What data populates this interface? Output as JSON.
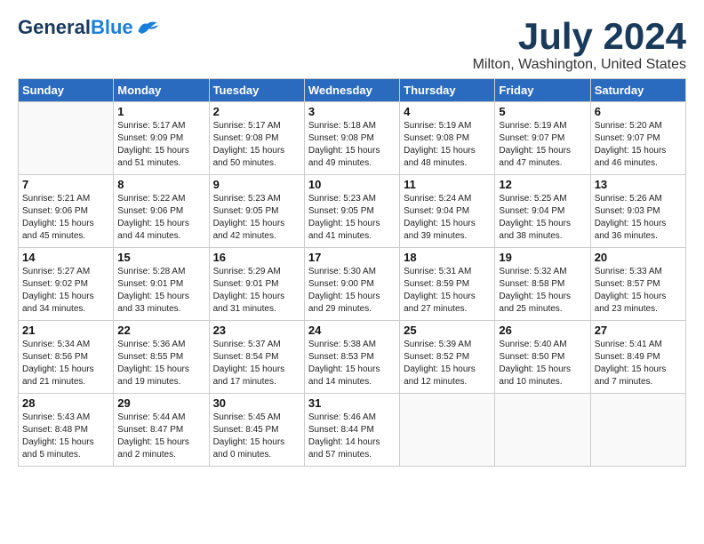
{
  "header": {
    "logo_general": "General",
    "logo_blue": "Blue",
    "month": "July 2024",
    "location": "Milton, Washington, United States"
  },
  "columns": [
    "Sunday",
    "Monday",
    "Tuesday",
    "Wednesday",
    "Thursday",
    "Friday",
    "Saturday"
  ],
  "weeks": [
    [
      {
        "day": "",
        "detail": ""
      },
      {
        "day": "1",
        "detail": "Sunrise: 5:17 AM\nSunset: 9:09 PM\nDaylight: 15 hours\nand 51 minutes."
      },
      {
        "day": "2",
        "detail": "Sunrise: 5:17 AM\nSunset: 9:08 PM\nDaylight: 15 hours\nand 50 minutes."
      },
      {
        "day": "3",
        "detail": "Sunrise: 5:18 AM\nSunset: 9:08 PM\nDaylight: 15 hours\nand 49 minutes."
      },
      {
        "day": "4",
        "detail": "Sunrise: 5:19 AM\nSunset: 9:08 PM\nDaylight: 15 hours\nand 48 minutes."
      },
      {
        "day": "5",
        "detail": "Sunrise: 5:19 AM\nSunset: 9:07 PM\nDaylight: 15 hours\nand 47 minutes."
      },
      {
        "day": "6",
        "detail": "Sunrise: 5:20 AM\nSunset: 9:07 PM\nDaylight: 15 hours\nand 46 minutes."
      }
    ],
    [
      {
        "day": "7",
        "detail": "Sunrise: 5:21 AM\nSunset: 9:06 PM\nDaylight: 15 hours\nand 45 minutes."
      },
      {
        "day": "8",
        "detail": "Sunrise: 5:22 AM\nSunset: 9:06 PM\nDaylight: 15 hours\nand 44 minutes."
      },
      {
        "day": "9",
        "detail": "Sunrise: 5:23 AM\nSunset: 9:05 PM\nDaylight: 15 hours\nand 42 minutes."
      },
      {
        "day": "10",
        "detail": "Sunrise: 5:23 AM\nSunset: 9:05 PM\nDaylight: 15 hours\nand 41 minutes."
      },
      {
        "day": "11",
        "detail": "Sunrise: 5:24 AM\nSunset: 9:04 PM\nDaylight: 15 hours\nand 39 minutes."
      },
      {
        "day": "12",
        "detail": "Sunrise: 5:25 AM\nSunset: 9:04 PM\nDaylight: 15 hours\nand 38 minutes."
      },
      {
        "day": "13",
        "detail": "Sunrise: 5:26 AM\nSunset: 9:03 PM\nDaylight: 15 hours\nand 36 minutes."
      }
    ],
    [
      {
        "day": "14",
        "detail": "Sunrise: 5:27 AM\nSunset: 9:02 PM\nDaylight: 15 hours\nand 34 minutes."
      },
      {
        "day": "15",
        "detail": "Sunrise: 5:28 AM\nSunset: 9:01 PM\nDaylight: 15 hours\nand 33 minutes."
      },
      {
        "day": "16",
        "detail": "Sunrise: 5:29 AM\nSunset: 9:01 PM\nDaylight: 15 hours\nand 31 minutes."
      },
      {
        "day": "17",
        "detail": "Sunrise: 5:30 AM\nSunset: 9:00 PM\nDaylight: 15 hours\nand 29 minutes."
      },
      {
        "day": "18",
        "detail": "Sunrise: 5:31 AM\nSunset: 8:59 PM\nDaylight: 15 hours\nand 27 minutes."
      },
      {
        "day": "19",
        "detail": "Sunrise: 5:32 AM\nSunset: 8:58 PM\nDaylight: 15 hours\nand 25 minutes."
      },
      {
        "day": "20",
        "detail": "Sunrise: 5:33 AM\nSunset: 8:57 PM\nDaylight: 15 hours\nand 23 minutes."
      }
    ],
    [
      {
        "day": "21",
        "detail": "Sunrise: 5:34 AM\nSunset: 8:56 PM\nDaylight: 15 hours\nand 21 minutes."
      },
      {
        "day": "22",
        "detail": "Sunrise: 5:36 AM\nSunset: 8:55 PM\nDaylight: 15 hours\nand 19 minutes."
      },
      {
        "day": "23",
        "detail": "Sunrise: 5:37 AM\nSunset: 8:54 PM\nDaylight: 15 hours\nand 17 minutes."
      },
      {
        "day": "24",
        "detail": "Sunrise: 5:38 AM\nSunset: 8:53 PM\nDaylight: 15 hours\nand 14 minutes."
      },
      {
        "day": "25",
        "detail": "Sunrise: 5:39 AM\nSunset: 8:52 PM\nDaylight: 15 hours\nand 12 minutes."
      },
      {
        "day": "26",
        "detail": "Sunrise: 5:40 AM\nSunset: 8:50 PM\nDaylight: 15 hours\nand 10 minutes."
      },
      {
        "day": "27",
        "detail": "Sunrise: 5:41 AM\nSunset: 8:49 PM\nDaylight: 15 hours\nand 7 minutes."
      }
    ],
    [
      {
        "day": "28",
        "detail": "Sunrise: 5:43 AM\nSunset: 8:48 PM\nDaylight: 15 hours\nand 5 minutes."
      },
      {
        "day": "29",
        "detail": "Sunrise: 5:44 AM\nSunset: 8:47 PM\nDaylight: 15 hours\nand 2 minutes."
      },
      {
        "day": "30",
        "detail": "Sunrise: 5:45 AM\nSunset: 8:45 PM\nDaylight: 15 hours\nand 0 minutes."
      },
      {
        "day": "31",
        "detail": "Sunrise: 5:46 AM\nSunset: 8:44 PM\nDaylight: 14 hours\nand 57 minutes."
      },
      {
        "day": "",
        "detail": ""
      },
      {
        "day": "",
        "detail": ""
      },
      {
        "day": "",
        "detail": ""
      }
    ]
  ]
}
